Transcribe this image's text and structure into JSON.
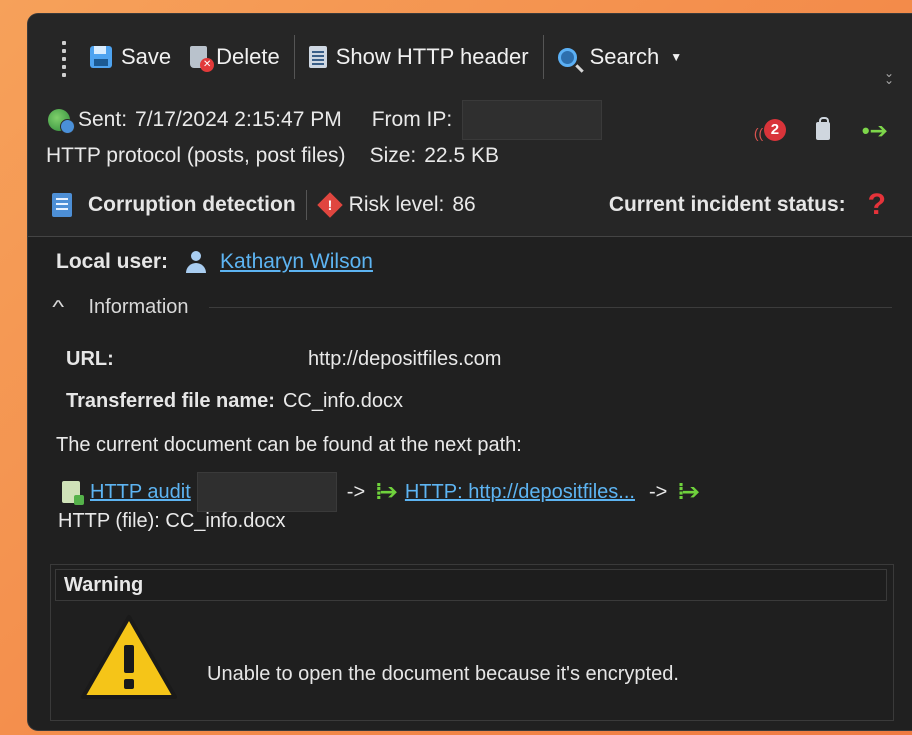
{
  "toolbar": {
    "save_label": "Save",
    "delete_label": "Delete",
    "show_header_label": "Show HTTP header",
    "search_label": "Search"
  },
  "meta": {
    "sent_label": "Sent:",
    "sent_value": "7/17/2024 2:15:47 PM",
    "from_ip_label": "From IP:",
    "protocol_text": "HTTP protocol (posts, post files)",
    "size_label": "Size:",
    "size_value": "22.5 KB",
    "notification_count": "2"
  },
  "incident": {
    "policy_name": "Corruption detection",
    "risk_label": "Risk level:",
    "risk_value": "86",
    "status_label": "Current incident status:",
    "status_value": "?"
  },
  "user": {
    "label": "Local user:",
    "name": "Katharyn Wilson"
  },
  "information": {
    "header": "Information",
    "url_label": "URL:",
    "url_value": "http://depositfiles.com",
    "file_label": "Transferred file name:",
    "file_value": "CC_info.docx",
    "path_intro": "The current document can be found at the next path:",
    "path_first": "HTTP audit",
    "path_sep": "->",
    "path_second": "HTTP: http://depositfiles...",
    "path_final": "HTTP (file): CC_info.docx"
  },
  "warning": {
    "title": "Warning",
    "message": "Unable to open the document because it's encrypted."
  },
  "colors": {
    "accent_link": "#5db4f2",
    "risk_red": "#e0463f",
    "arrow_green": "#6fd23c",
    "warning_yellow": "#f5c518"
  }
}
